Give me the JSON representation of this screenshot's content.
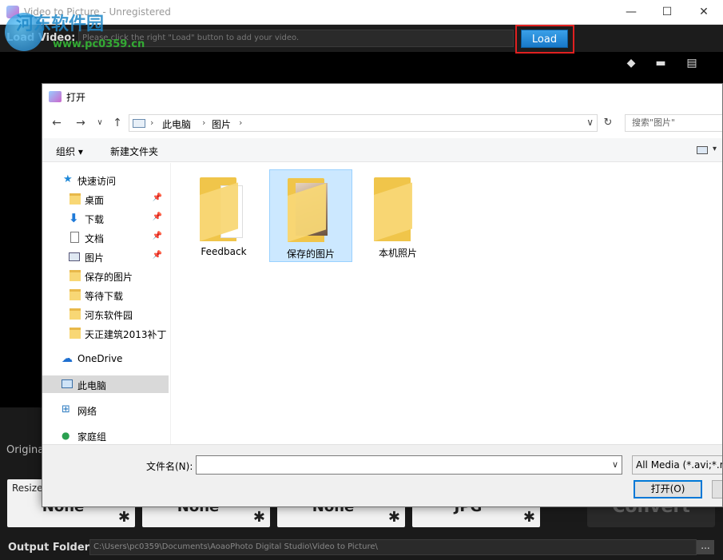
{
  "app": {
    "title": "Video to Picture - Unregistered",
    "watermark": "河东软件园",
    "watermark_url": "www.pc0359.cn",
    "load_label": "Load Video:",
    "load_placeholder": "Please click the right \"Load\" button to add your video.",
    "load_button": "Load",
    "original_label": "Origina",
    "resize_label": "Resize",
    "cards": [
      "None",
      "None",
      "None",
      "JPG"
    ],
    "convert_label": "Convert",
    "output_label": "Output Folder:",
    "output_path": "C:\\Users\\pc0359\\Documents\\AoaoPhoto Digital Studio\\Video to Picture\\",
    "output_browse": "...",
    "accent_color": "#1e88d8",
    "highlight_color": "#e02020"
  },
  "dialog": {
    "title": "打开",
    "breadcrumb": [
      "此电脑",
      "图片"
    ],
    "search_placeholder": "搜索\"图片\"",
    "toolbar": {
      "organize": "组织 ▾",
      "new_folder": "新建文件夹"
    },
    "nav": {
      "quick_access": "快速访问",
      "pinned": [
        {
          "label": "桌面",
          "icon": "desktop-folder-icon"
        },
        {
          "label": "下载",
          "icon": "download-arrow-icon"
        },
        {
          "label": "文档",
          "icon": "document-icon"
        },
        {
          "label": "图片",
          "icon": "pictures-icon"
        }
      ],
      "folders": [
        "保存的图片",
        "等待下载",
        "河东软件园",
        "天正建筑2013补丁"
      ],
      "onedrive": "OneDrive",
      "this_pc": "此电脑",
      "network": "网络",
      "homegroup": "家庭组"
    },
    "files": [
      {
        "name": "Feedback"
      },
      {
        "name": "保存的图片"
      },
      {
        "name": "本机照片"
      }
    ],
    "filename_label": "文件名(N):",
    "filename_value": "",
    "filter": "All Media (*.avi;*.m",
    "open_button": "打开(O)"
  }
}
